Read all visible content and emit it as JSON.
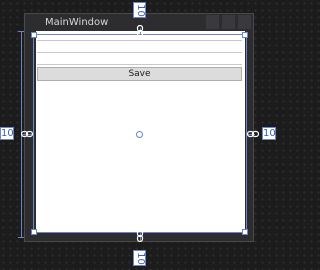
{
  "window": {
    "title": "MainWindow"
  },
  "form": {
    "save_label": "Save"
  },
  "margins": {
    "top": "10",
    "bottom": "10",
    "left": "10",
    "right": "10"
  },
  "colors": {
    "canvas_background": "#1c1c1c",
    "window_chrome": "#2d2d30",
    "client_area": "#ffffff",
    "adorner_accent": "#6a86c4",
    "button_face": "#dcdcdc"
  },
  "icons": {
    "anchor": "chain-link-icon"
  }
}
